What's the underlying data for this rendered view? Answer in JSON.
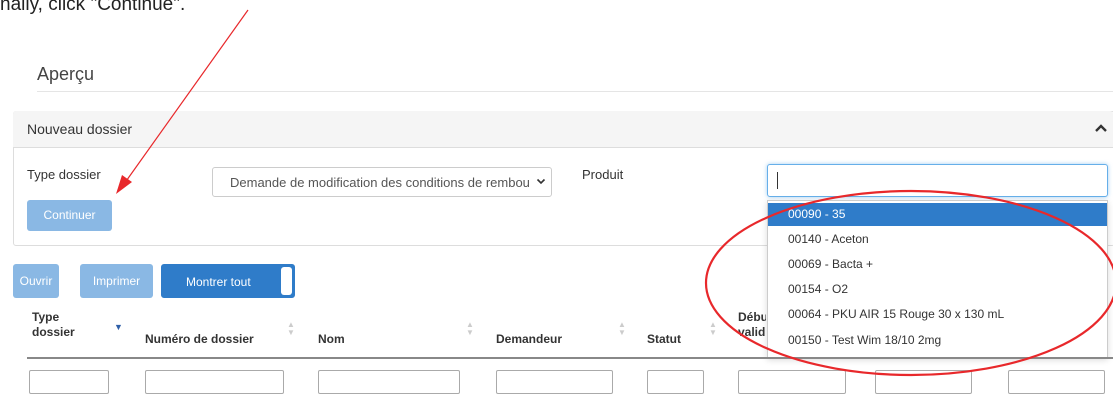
{
  "instruction": "nally, click \"Continue\".",
  "apercu": {
    "title": "Aperçu"
  },
  "panel": {
    "title": "Nouveau dossier",
    "type_label": "Type dossier",
    "type_value": "Demande de modification des conditions de rembourse",
    "produit_label": "Produit",
    "continue_label": "Continuer",
    "produit_input_value": "",
    "produit_options": [
      {
        "label": "00090 - 35",
        "selected": true
      },
      {
        "label": "00140 - Aceton",
        "selected": false
      },
      {
        "label": "00069 - Bacta +",
        "selected": false
      },
      {
        "label": "00154 - O2",
        "selected": false
      },
      {
        "label": "00064 - PKU AIR 15 Rouge 30 x 130 mL",
        "selected": false
      },
      {
        "label": "00150 - Test Wim 18/10 2mg",
        "selected": false
      }
    ]
  },
  "toolbar": {
    "ouvrir": "Ouvrir",
    "imprimer": "Imprimer",
    "montrer_tout": "Montrer tout"
  },
  "table": {
    "headers": [
      "Type dossier",
      "Numéro de dossier",
      "Nom",
      "Demandeur",
      "Statut",
      "Début validité"
    ]
  },
  "colors": {
    "primary": "#2f7cc9",
    "disabled": "#8ab8e4",
    "annotation": "#e8282b"
  }
}
